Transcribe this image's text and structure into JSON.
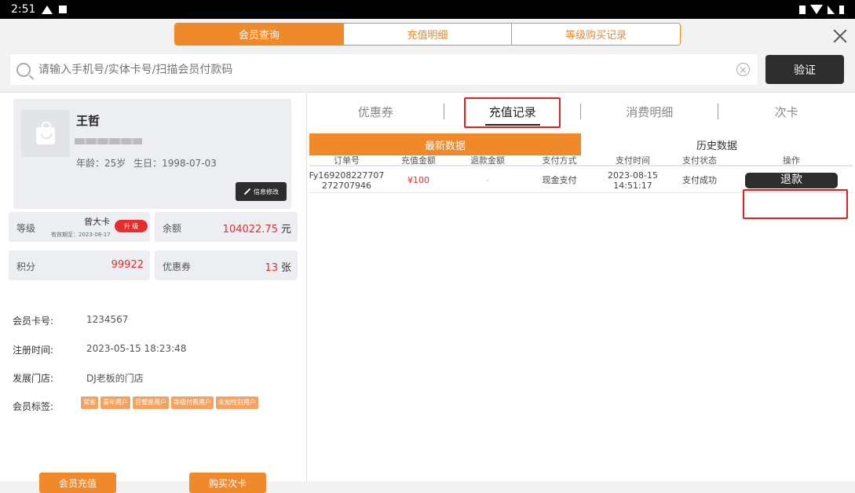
{
  "status_bar": {
    "time": "2:51"
  },
  "top_tabs": [
    "会员查询",
    "充值明细",
    "等级购买记录"
  ],
  "search": {
    "placeholder": "请输入手机号/实体卡号/扫描会员付款码",
    "verify_label": "验证"
  },
  "member": {
    "name": "王哲",
    "age": "年龄：25岁",
    "birthday": "生日：1998-07-03",
    "edit_label": "信息修改",
    "level_label": "等级",
    "level_name": "曾大卡",
    "level_expiry": "有效期至：2023-08-17",
    "upgrade_label": "升 级",
    "balance_label": "余额",
    "balance_value": "104022.75",
    "balance_unit": "元",
    "points_label": "积分",
    "points_value": "99922",
    "coupon_label": "优惠券",
    "coupon_value": "13",
    "coupon_unit": "张",
    "card_no_label": "会员卡号:",
    "card_no": "1234567",
    "reg_time_label": "注册时间:",
    "reg_time": "2023-05-15 18:23:48",
    "store_label": "发展门店:",
    "store": "DJ老板的门店",
    "tags_label": "会员标签:",
    "tags": [
      "常客",
      "青年用户",
      "巨蟹座用户",
      "等级付费用户",
      "未知性别用户"
    ]
  },
  "bottom_buttons": {
    "recharge": "会员充值",
    "buy_card": "购买次卡"
  },
  "sub_tabs": [
    "优惠券",
    "充值记录",
    "消费明细",
    "次卡"
  ],
  "data_tabs": [
    "最新数据",
    "历史数据"
  ],
  "table": {
    "headers": [
      "订单号",
      "充值金额",
      "退款金额",
      "支付方式",
      "支付时间",
      "支付状态",
      "操作"
    ],
    "rows": [
      {
        "order_no_line1": "Fy169208227707",
        "order_no_line2": "272707946",
        "amount": "¥100",
        "refund": "-",
        "method": "现金支付",
        "time_line1": "2023-08-15",
        "time_line2": "14:51:17",
        "status": "支付成功",
        "action": "退款"
      }
    ]
  },
  "colors": {
    "accent": "#f0892a",
    "danger": "#e52d2d",
    "dark": "#2d2d2d",
    "highlight": "#e02020"
  }
}
